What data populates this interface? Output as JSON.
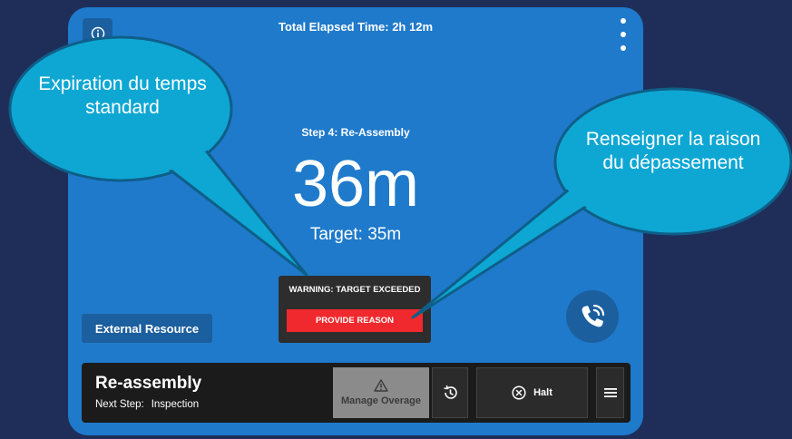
{
  "header": {
    "elapsed_text": "Total Elapsed Time: 2h 12m"
  },
  "step": {
    "title": "Step 4: Re-Assembly",
    "elapsed": "36m",
    "target": "Target: 35m"
  },
  "warning": {
    "text": "WARNING: TARGET EXCEEDED",
    "button_label": "PROVIDE REASON"
  },
  "external_resource_label": "External Resource",
  "bottom_bar": {
    "title": "Re-assembly",
    "next_step_label": "Next Step:",
    "next_step_value": "Inspection",
    "overage_label": "Manage Overage",
    "halt_label": "Halt"
  },
  "callouts": {
    "left": "Expiration du temps standard",
    "right": "Renseigner la raison du dépassement"
  },
  "icons": {
    "info": "info-icon",
    "more": "more-vertical-icon",
    "phone": "phone-icon",
    "warning": "warning-triangle-icon",
    "history": "history-icon",
    "halt": "close-circle-icon",
    "menu": "hamburger-menu-icon"
  },
  "colors": {
    "background": "#1e2e59",
    "panel": "#1f7acb",
    "callout": "#0ea7d4",
    "alert": "#f0292e",
    "dark_bar": "#1b1b1b"
  }
}
